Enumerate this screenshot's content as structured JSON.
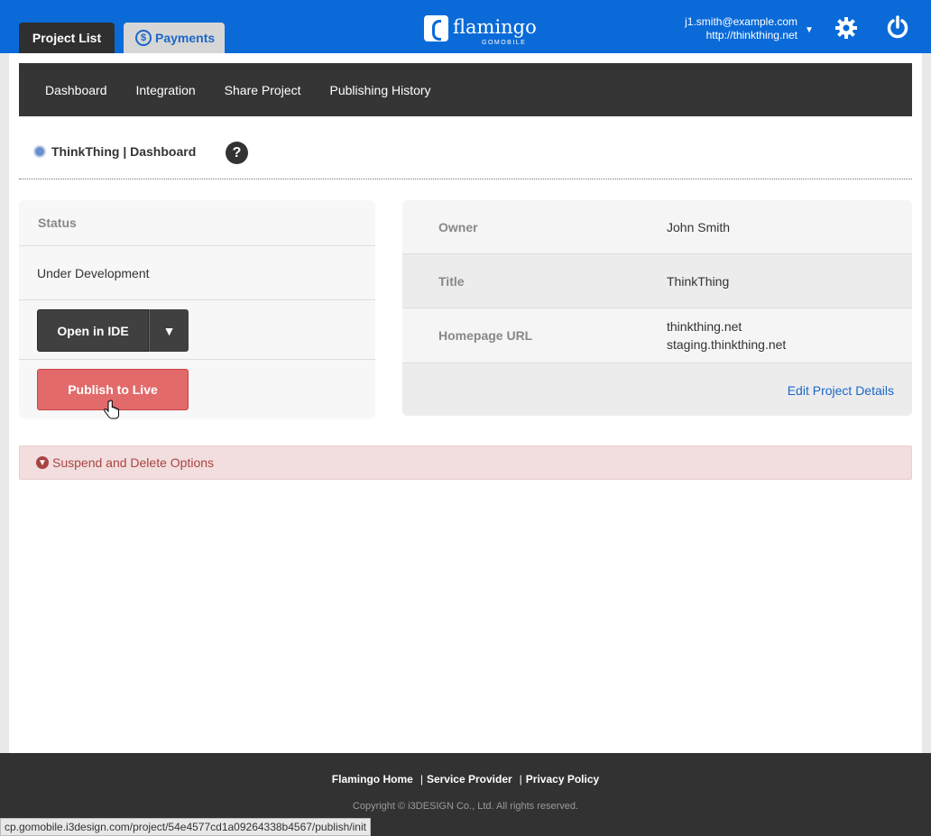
{
  "header": {
    "tabs": [
      {
        "label": "Project List",
        "active": true
      },
      {
        "label": "Payments",
        "active": false
      }
    ],
    "logo": {
      "name": "flamingo",
      "sub": "GOMOBILE"
    },
    "user": {
      "email": "j1.smith@example.com",
      "site": "http://thinkthing.net"
    },
    "icons": {
      "settings": "gear-icon",
      "logout": "power-icon",
      "user_menu": "caret-down-icon"
    },
    "colors": {
      "bar": "#0a6ad8",
      "active_tab": "#2f2f2f"
    }
  },
  "subnav": {
    "items": [
      "Dashboard",
      "Integration",
      "Share Project",
      "Publishing History"
    ]
  },
  "breadcrumb": {
    "text": "ThinkThing | Dashboard",
    "help": "?"
  },
  "status_card": {
    "heading": "Status",
    "value": "Under Development",
    "open_ide_label": "Open in IDE",
    "publish_label": "Publish to Live",
    "publish_color": "#e36a6a"
  },
  "details_card": {
    "rows": [
      {
        "key": "Owner",
        "values": [
          "John Smith"
        ]
      },
      {
        "key": "Title",
        "values": [
          "ThinkThing"
        ]
      },
      {
        "key": "Homepage URL",
        "values": [
          "thinkthing.net",
          "staging.thinkthing.net"
        ]
      }
    ],
    "edit_link": "Edit Project Details"
  },
  "suspend": {
    "label": "Suspend and Delete Options"
  },
  "footer": {
    "links": [
      "Flamingo Home",
      "Service Provider",
      "Privacy Policy"
    ],
    "copyright": "Copyright © i3DESIGN Co., Ltd. All rights reserved."
  },
  "statusbar": {
    "url": "cp.gomobile.i3design.com/project/54e4577cd1a09264338b4567/publish/init"
  }
}
